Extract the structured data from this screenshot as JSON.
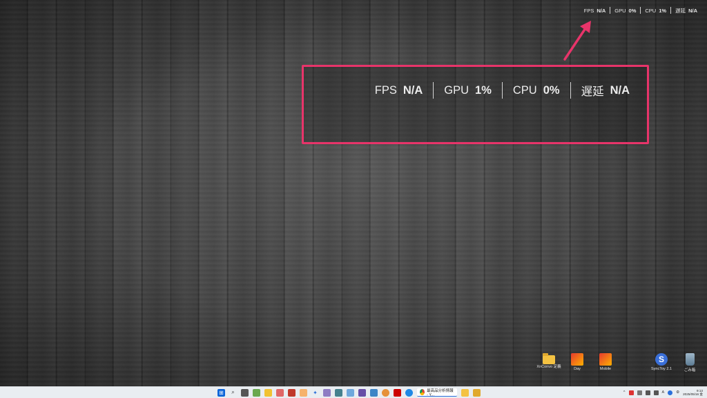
{
  "overlay": {
    "items": [
      {
        "label": "FPS",
        "value": "N/A"
      },
      {
        "label": "GPU",
        "value": "0%"
      },
      {
        "label": "CPU",
        "value": "1%"
      },
      {
        "label": "遅延",
        "value": "N/A"
      }
    ]
  },
  "callout": {
    "items": [
      {
        "label": "FPS",
        "value": "N/A"
      },
      {
        "label": "GPU",
        "value": "1%"
      },
      {
        "label": "CPU",
        "value": "0%"
      },
      {
        "label": "遅延",
        "value": "N/A"
      }
    ],
    "border_color": "#e8346a"
  },
  "desktop_icons": [
    {
      "label": "XnConvo 定義",
      "icon": "folder-icon"
    },
    {
      "label": "Day",
      "icon": "app-icon"
    },
    {
      "label": "Mobile",
      "icon": "app-icon"
    },
    {
      "label": "SyncToy 2.1",
      "icon": "synctoy-icon"
    },
    {
      "label": "ごみ箱",
      "icon": "recycle-bin-icon"
    }
  ],
  "taskbar": {
    "active_window_title": "最高品分析情報 - Y...",
    "clock_time": "9:13",
    "clock_date": "2025/05/16 金",
    "tray_language": "A"
  }
}
